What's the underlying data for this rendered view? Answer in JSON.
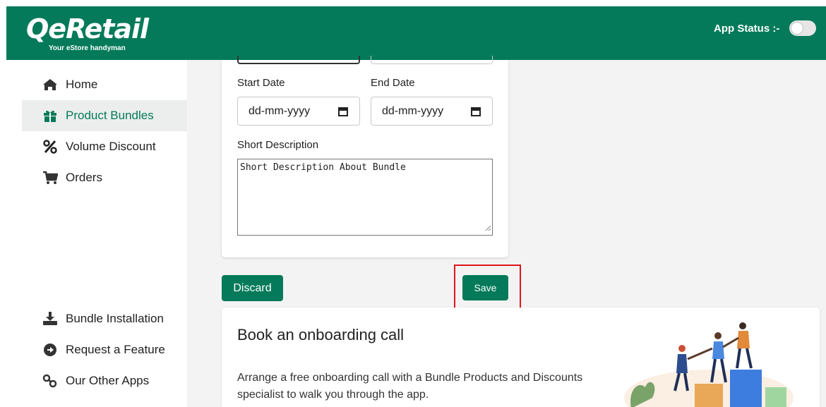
{
  "header": {
    "logo_text": "QeRetail",
    "logo_tagline": "Your eStore handyman",
    "app_status_label": "App Status :-"
  },
  "sidebar": {
    "items": [
      {
        "label": "Home",
        "icon": "home-icon"
      },
      {
        "label": "Product Bundles",
        "icon": "gift-icon",
        "active": true
      },
      {
        "label": "Volume Discount",
        "icon": "percent-icon"
      },
      {
        "label": "Orders",
        "icon": "cart-icon"
      }
    ],
    "bottom_items": [
      {
        "label": "Bundle Installation",
        "icon": "download-icon"
      },
      {
        "label": "Request a Feature",
        "icon": "arrow-circle-right-icon"
      },
      {
        "label": "Our Other Apps",
        "icon": "link-icon"
      }
    ]
  },
  "form": {
    "start_date_label": "Start Date",
    "end_date_label": "End Date",
    "start_date_placeholder": "dd-mm-yyyy",
    "end_date_placeholder": "dd-mm-yyyy",
    "short_description_label": "Short Description",
    "short_description_value": "Short Description About Bundle"
  },
  "actions": {
    "discard_label": "Discard",
    "save_label": "Save"
  },
  "onboarding": {
    "title": "Book an onboarding call",
    "text": "Arrange a free onboarding call with a Bundle Products and Discounts specialist to walk you through the app."
  },
  "colors": {
    "brand": "#047a5a",
    "highlight": "#e0141c"
  }
}
